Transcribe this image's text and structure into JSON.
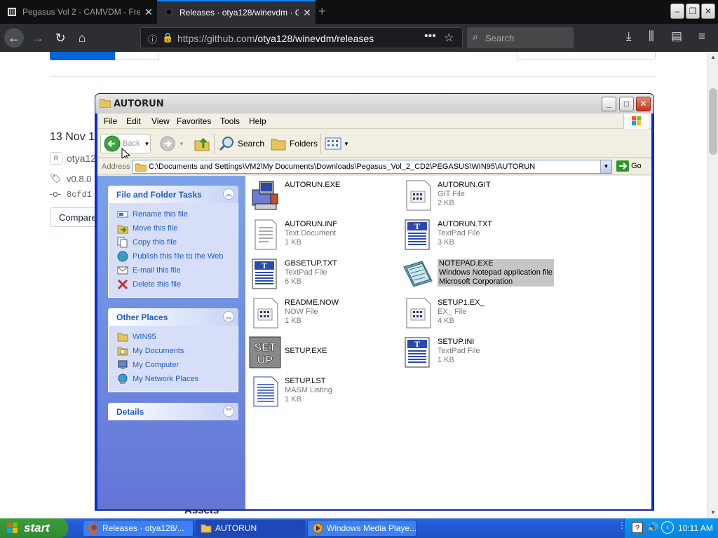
{
  "browser": {
    "tabs": [
      {
        "title": "Pegasus Vol 2 - CAMVDM - Free..."
      },
      {
        "title": "Releases · otya128/winevdm · Gi..."
      }
    ],
    "url_host": "https://github.com",
    "url_path": "/otya128/winevdm/releases",
    "search_placeholder": "Search"
  },
  "github": {
    "release_date": "13 Nov 12",
    "author": "otya12",
    "author_avatar": "R",
    "tag": "v0.8.0",
    "commit": "8cfd1",
    "compare_label": "Compare",
    "about_label": "Assets"
  },
  "explorer": {
    "title": "AUTORUN",
    "menu": [
      "File",
      "Edit",
      "View",
      "Favorites",
      "Tools",
      "Help"
    ],
    "toolbar": {
      "back": "Back",
      "search": "Search",
      "folders": "Folders"
    },
    "address_label": "Address",
    "address_path": "C:\\Documents and Settings\\VM2\\My Documents\\Downloads\\Pegasus_Vol_2_CD2\\PEGASUS\\WIN95\\AUTORUN",
    "go_label": "Go",
    "tasks_panel": {
      "title": "File and Folder Tasks",
      "items": [
        "Rename this file",
        "Move this file",
        "Copy this file",
        "Publish this file to the Web",
        "E-mail this file",
        "Delete this file"
      ]
    },
    "places_panel": {
      "title": "Other Places",
      "items": [
        "WIN95",
        "My Documents",
        "My Computer",
        "My Network Places"
      ]
    },
    "details_panel": {
      "title": "Details"
    },
    "files": [
      {
        "name": "AUTORUN.EXE",
        "type": "",
        "size": "",
        "icon": "installer-icon"
      },
      {
        "name": "AUTORUN.GIT",
        "type": "GIT File",
        "size": "2 KB",
        "icon": "generic-file-icon"
      },
      {
        "name": "AUTORUN.INF",
        "type": "Text Document",
        "size": "1 KB",
        "icon": "text-document-icon"
      },
      {
        "name": "AUTORUN.TXT",
        "type": "TextPad File",
        "size": "3 KB",
        "icon": "textpad-icon"
      },
      {
        "name": "GBSETUP.TXT",
        "type": "TextPad File",
        "size": "6 KB",
        "icon": "textpad-icon"
      },
      {
        "name": "NOTEPAD.EXE",
        "type": "Windows Notepad application file",
        "size": "Microsoft Corporation",
        "icon": "notepad-icon"
      },
      {
        "name": "README.NOW",
        "type": "NOW File",
        "size": "1 KB",
        "icon": "generic-file-icon"
      },
      {
        "name": "SETUP1.EX_",
        "type": "EX_ File",
        "size": "4 KB",
        "icon": "generic-file-icon"
      },
      {
        "name": "SETUP.EXE",
        "type": "",
        "size": "",
        "icon": "setup-icon"
      },
      {
        "name": "SETUP.INI",
        "type": "TextPad File",
        "size": "1 KB",
        "icon": "textpad-icon"
      },
      {
        "name": "SETUP.LST",
        "type": "MASM Listing",
        "size": "1 KB",
        "icon": "listing-icon"
      }
    ],
    "selected_file": "NOTEPAD.EXE"
  },
  "taskbar": {
    "start_label": "start",
    "tasks": [
      {
        "label": "Releases · otya128/..."
      },
      {
        "label": "AUTORUN"
      },
      {
        "label": "Windows Media Playe..."
      }
    ],
    "clock": "10:11 AM"
  },
  "colors": {
    "xp_blue": "#0831d9",
    "task_pane_top": "#7ba2e7",
    "task_pane_bottom": "#6375d6",
    "task_link": "#215dc6",
    "firefox_dark": "#2c2e33",
    "github_blue": "#0366d6",
    "selection_gray": "#c6c6c6"
  }
}
